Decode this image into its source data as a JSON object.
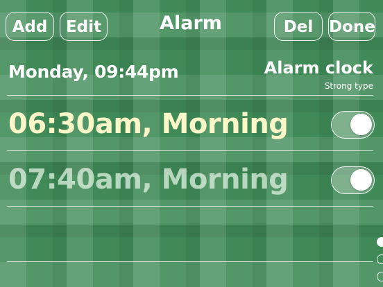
{
  "header": {
    "add_label": "Add",
    "edit_label": "Edit",
    "title": "Alarm",
    "del_label": "Del",
    "done_label": "Done"
  },
  "status": {
    "date_time": "Monday, 09:44pm",
    "mode_title": "Alarm clock",
    "mode_subtitle": "Strong type"
  },
  "alarms": [
    {
      "label": "06:30am, Morning",
      "enabled": true
    },
    {
      "label": "07:40am, Morning",
      "enabled": true
    }
  ],
  "pager": {
    "page_count": 3,
    "current_page": 1
  },
  "colors": {
    "background": "#3f8a57",
    "active_alarm_text": "#fcf7c9",
    "inactive_alarm_text": "#d8ecd8"
  }
}
